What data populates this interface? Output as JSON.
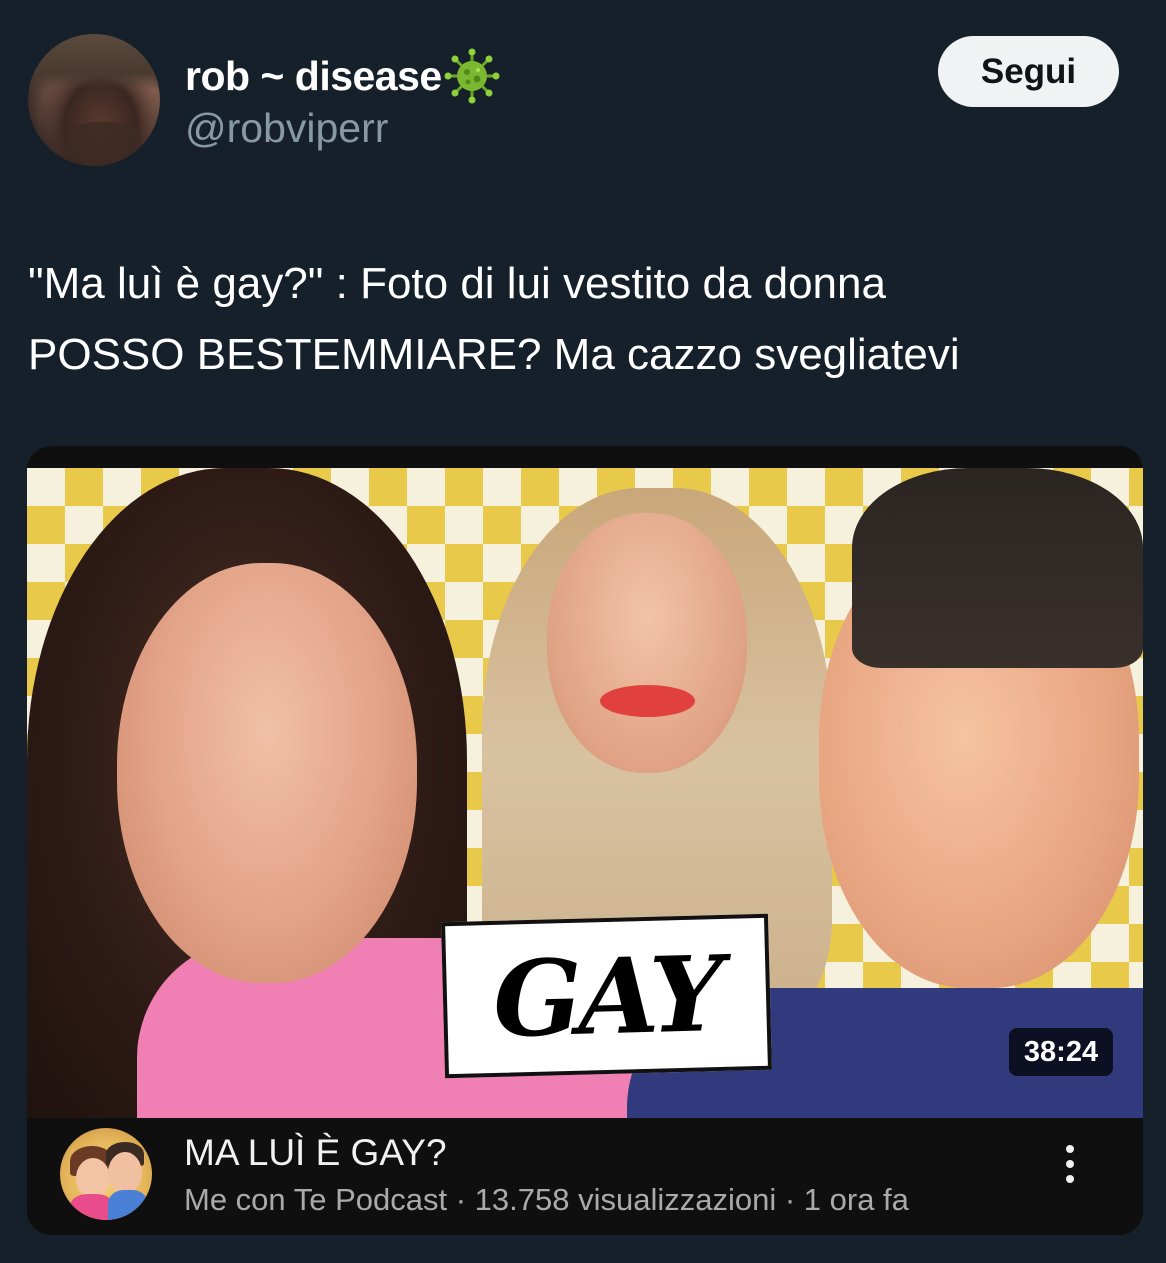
{
  "user": {
    "display_name": "rob ~ disease",
    "name_emoji": "virus-icon",
    "handle": "@robviperr",
    "follow_label": "Segui"
  },
  "tweet": {
    "lines": [
      "\"Ma luì è gay?\" : Foto di lui vestito da donna",
      "POSSO BESTEMMIARE? Ma cazzo svegliatevi"
    ]
  },
  "video": {
    "thumbnail_caption": "GAY",
    "duration": "38:24",
    "title": "MA LUÌ È GAY?",
    "channel": "Me con Te Podcast",
    "views": "13.758 visualizzazioni",
    "age": "1 ora fa",
    "separator": " · "
  },
  "colors": {
    "background": "#15202b",
    "follow_bg": "#eff3f4",
    "handle_gray": "#8899a6",
    "card_bg": "#0f0f0f",
    "virus_green": "#7cb82f"
  }
}
